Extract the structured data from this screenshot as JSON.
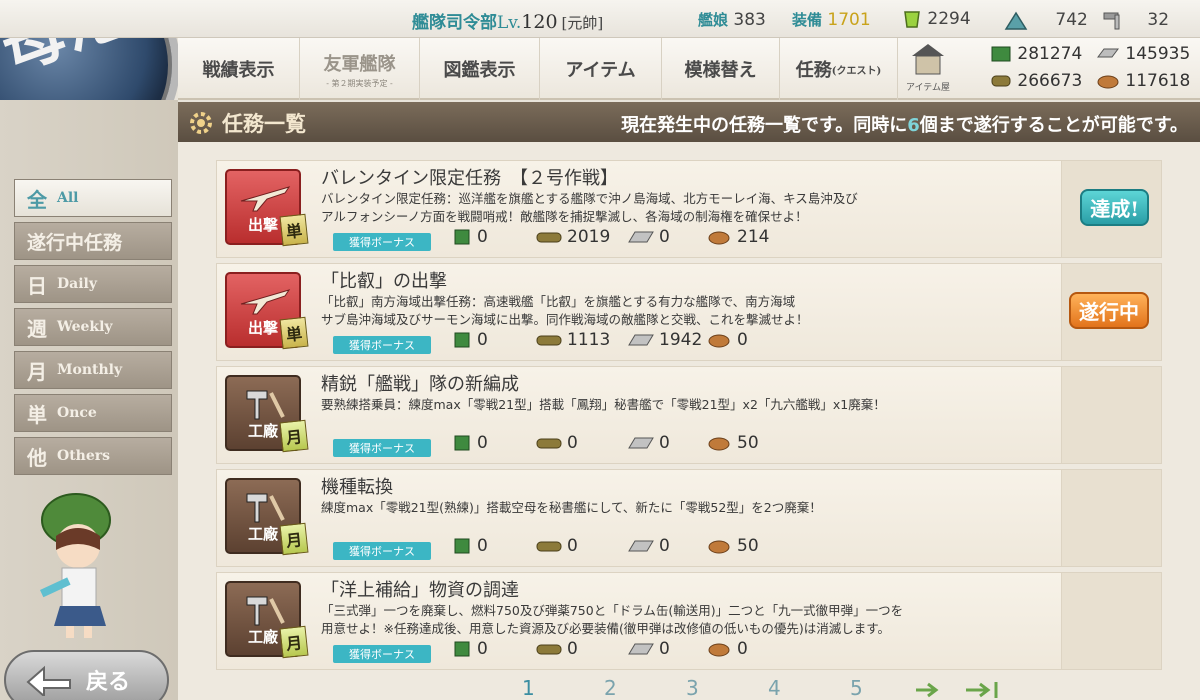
{
  "topbar": {
    "hq": "艦隊司令部",
    "lv_label": "Lv.",
    "level": "120",
    "rank": "[元帥]",
    "shipgirls_label": "艦娘",
    "shipgirls": "383",
    "equip_label": "装備",
    "equip": "1701",
    "bucket": "2294",
    "devmat": "742",
    "screw": "32"
  },
  "menu": {
    "items": [
      {
        "label": "戦績表示"
      },
      {
        "label": "友軍艦隊",
        "sub": "- 第２期実装予定 -"
      },
      {
        "label": "図鑑表示"
      },
      {
        "label": "アイテム"
      },
      {
        "label": "模様替え"
      },
      {
        "label": "任務",
        "small": "(クエスト)"
      }
    ],
    "shop": "アイテム屋",
    "resources": {
      "fuel": "281274",
      "steel": "145935",
      "ammo": "266673",
      "bauxite": "117618"
    }
  },
  "header": {
    "title": "任務一覧",
    "note_pre": "現在発生中の任務一覧です。同時に",
    "note_num": "6",
    "note_post": "個まで遂行することが可能です。"
  },
  "tabs": [
    {
      "k": "全",
      "e": "All"
    },
    {
      "k": "遂行中任務",
      "e": ""
    },
    {
      "k": "日",
      "e": "Daily"
    },
    {
      "k": "週",
      "e": "Weekly"
    },
    {
      "k": "月",
      "e": "Monthly"
    },
    {
      "k": "単",
      "e": "Once"
    },
    {
      "k": "他",
      "e": "Others"
    }
  ],
  "quests": [
    {
      "category": "出撃",
      "badge": "単",
      "title": "バレンタイン限定任務　【２号作戦】",
      "desc1": "バレンタイン限定任務：巡洋艦を旗艦とする艦隊で沖ノ島海域、北方モーレイ海、キス島沖及び",
      "desc2": "アルフォンシーノ方面を戦闘哨戒！敵艦隊を捕捉撃滅し、各海域の制海権を確保せよ！",
      "bonus": "獲得ボーナス",
      "fuel": "0",
      "ammo": "2019",
      "steel": "0",
      "baux": "214",
      "status": "達成!"
    },
    {
      "category": "出撃",
      "badge": "単",
      "title": "「比叡」の出撃",
      "desc1": "「比叡」南方海域出撃任務：高速戦艦「比叡」を旗艦とする有力な艦隊で、南方海域",
      "desc2": "サブ島沖海域及びサーモン海域に出撃。同作戦海域の敵艦隊と交戦、これを撃滅せよ！",
      "bonus": "獲得ボーナス",
      "fuel": "0",
      "ammo": "1113",
      "steel": "1942",
      "baux": "0",
      "status": "遂行中"
    },
    {
      "category": "工廠",
      "badge": "月",
      "title": "精鋭「艦戦」隊の新編成",
      "desc1": "要熟練搭乗員：練度max「零戦21型」搭載「鳳翔」秘書艦で「零戦21型」x2「九六艦戦」x1廃棄！",
      "desc2": "",
      "bonus": "獲得ボーナス",
      "fuel": "0",
      "ammo": "0",
      "steel": "0",
      "baux": "50",
      "status": ""
    },
    {
      "category": "工廠",
      "badge": "月",
      "title": "機種転換",
      "desc1": "練度max「零戦21型(熟練)」搭載空母を秘書艦にして、新たに「零戦52型」を2つ廃棄！",
      "desc2": "",
      "bonus": "獲得ボーナス",
      "fuel": "0",
      "ammo": "0",
      "steel": "0",
      "baux": "50",
      "status": ""
    },
    {
      "category": "工廠",
      "badge": "月",
      "title": "「洋上補給」物資の調達",
      "desc1": "「三式弾」一つを廃棄し、燃料750及び弾薬750と「ドラム缶(輸送用)」二つと「九一式徹甲弾」一つを",
      "desc2": "用意せよ！※任務達成後、用意した資源及び必要装備(徹甲弾は改修値の低いもの優先)は消滅します。",
      "bonus": "獲得ボーナス",
      "fuel": "0",
      "ammo": "0",
      "steel": "0",
      "baux": "0",
      "status": ""
    }
  ],
  "pager": [
    "1",
    "2",
    "3",
    "4",
    "5"
  ],
  "back": "戻る",
  "colors": {
    "accent": "#3cb6c4",
    "header": "#6b5d4d",
    "sortie": "#c94040",
    "arsenal": "#6e503e"
  }
}
